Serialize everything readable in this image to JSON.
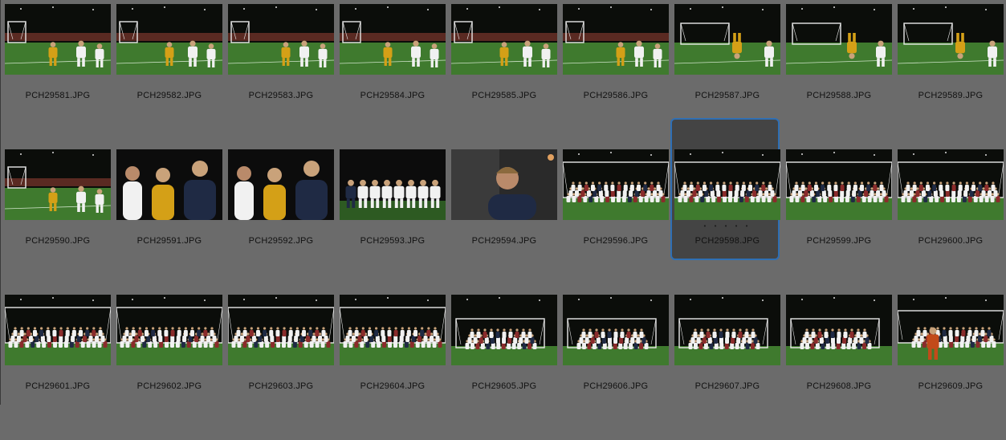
{
  "photos": [
    {
      "filename": "PCH29581.JPG",
      "scene": "action"
    },
    {
      "filename": "PCH29582.JPG",
      "scene": "action"
    },
    {
      "filename": "PCH29583.JPG",
      "scene": "action"
    },
    {
      "filename": "PCH29584.JPG",
      "scene": "action"
    },
    {
      "filename": "PCH29585.JPG",
      "scene": "action"
    },
    {
      "filename": "PCH29586.JPG",
      "scene": "action"
    },
    {
      "filename": "PCH29587.JPG",
      "scene": "flip"
    },
    {
      "filename": "PCH29588.JPG",
      "scene": "flip"
    },
    {
      "filename": "PCH29589.JPG",
      "scene": "flip"
    },
    {
      "filename": "PCH29590.JPG",
      "scene": "action"
    },
    {
      "filename": "PCH29591.JPG",
      "scene": "crowd"
    },
    {
      "filename": "PCH29592.JPG",
      "scene": "crowd"
    },
    {
      "filename": "PCH29593.JPG",
      "scene": "team-standing"
    },
    {
      "filename": "PCH29594.JPG",
      "scene": "portrait"
    },
    {
      "filename": "PCH29596.JPG",
      "scene": "group"
    },
    {
      "filename": "PCH29598.JPG",
      "scene": "group",
      "selected": true,
      "rating_dots": "• • • • •"
    },
    {
      "filename": "PCH29599.JPG",
      "scene": "group"
    },
    {
      "filename": "PCH29600.JPG",
      "scene": "group"
    },
    {
      "filename": "PCH29601.JPG",
      "scene": "group"
    },
    {
      "filename": "PCH29602.JPG",
      "scene": "group"
    },
    {
      "filename": "PCH29603.JPG",
      "scene": "group"
    },
    {
      "filename": "PCH29604.JPG",
      "scene": "group"
    },
    {
      "filename": "PCH29605.JPG",
      "scene": "group-wide"
    },
    {
      "filename": "PCH29606.JPG",
      "scene": "group-wide"
    },
    {
      "filename": "PCH29607.JPG",
      "scene": "group-wide"
    },
    {
      "filename": "PCH29608.JPG",
      "scene": "group-wide"
    },
    {
      "filename": "PCH29609.JPG",
      "scene": "group-coach"
    }
  ],
  "colors": {
    "background": "#6b6b6b",
    "selection_border": "#2f6fb4",
    "selection_fill": "#444444",
    "field": "#3f7a2e",
    "night_sky": "#0b0d0a",
    "jersey_white": "#f1f1f1",
    "jersey_gold": "#d4a017"
  }
}
